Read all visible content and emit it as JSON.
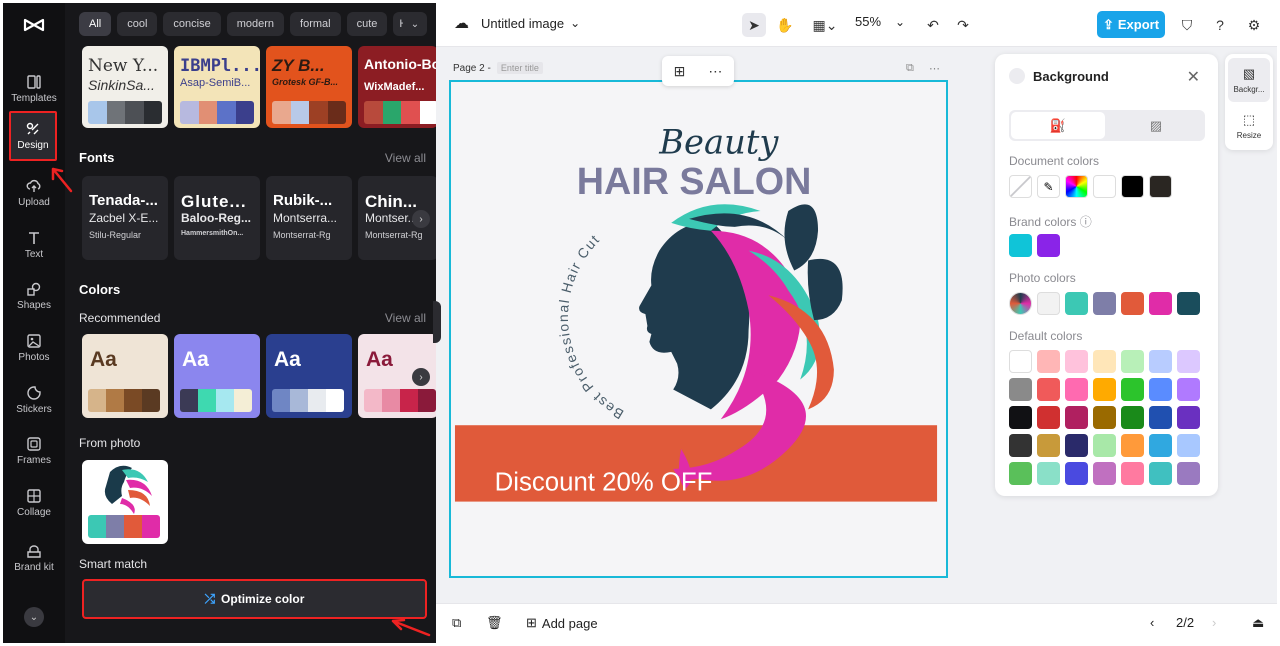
{
  "rail": {
    "items": [
      {
        "label": "Templates",
        "icon": "templates-icon"
      },
      {
        "label": "Design",
        "icon": "design-icon"
      },
      {
        "label": "Upload",
        "icon": "upload-icon"
      },
      {
        "label": "Text",
        "icon": "text-icon"
      },
      {
        "label": "Shapes",
        "icon": "shapes-icon"
      },
      {
        "label": "Photos",
        "icon": "photos-icon"
      },
      {
        "label": "Stickers",
        "icon": "stickers-icon"
      },
      {
        "label": "Frames",
        "icon": "frames-icon"
      },
      {
        "label": "Collage",
        "icon": "collage-icon"
      },
      {
        "label": "Brand kit",
        "icon": "brand-kit-icon"
      }
    ]
  },
  "panel": {
    "chips": [
      "All",
      "cool",
      "concise",
      "modern",
      "formal",
      "cute",
      "Holi"
    ],
    "theme_cards": [
      {
        "t1": "New Y...",
        "t2": "SinkinSa...",
        "bg": "#f1efe9",
        "fg": "#333",
        "swatches": [
          "#a8c6ea",
          "#6f7378",
          "#4d5055",
          "#2a2d31"
        ]
      },
      {
        "t1": "IBMPl...",
        "t2": "Asap-SemiB...",
        "bg": "#f3e4b8",
        "fg": "#3b3f8c",
        "swatches": [
          "#b7b9df",
          "#e18f74",
          "#5c72c8",
          "#3b3f8c"
        ]
      },
      {
        "t1": "ZY B...",
        "t2": "Grotesk GF-B...",
        "bg": "#e2531d",
        "fg": "#2b1a12",
        "swatches": [
          "#e9a88e",
          "#b8c9e8",
          "#9d4024",
          "#6a2c1a"
        ]
      },
      {
        "t1": "Antonio-Bo",
        "t2": "WixMadef...",
        "bg": "#8c1d23",
        "fg": "#fff",
        "swatches": [
          "#b84a3c",
          "#2aa66b",
          "#e05050",
          "#ffffff"
        ]
      }
    ],
    "fonts_title": "Fonts",
    "fonts_view_all": "View all",
    "font_cards": [
      {
        "a": "Tenada-...",
        "b": "Zacbel X-E...",
        "c": "Stilu-Regular"
      },
      {
        "a": "Glute...",
        "b": "Baloo-Reg...",
        "c": "HammersmithOn..."
      },
      {
        "a": "Rubik-...",
        "b": "Montserra...",
        "c": "Montserrat-Rg"
      },
      {
        "a": "Chin...",
        "b": "Montser...",
        "c": "Montserrat-Rg"
      }
    ],
    "colors_title": "Colors",
    "recommended_label": "Recommended",
    "colors_view_all": "View all",
    "color_cards": [
      {
        "aa": "Aa",
        "bg": "#efe4d6",
        "fg": "#5a3a22",
        "swatches": [
          "#d6b48a",
          "#b07a45",
          "#7a4a25",
          "#5a3a22"
        ]
      },
      {
        "aa": "Aa",
        "bg": "#8b86ee",
        "fg": "#fff",
        "swatches": [
          "#3b3a55",
          "#3ed9b0",
          "#a6e8f0",
          "#f4eed6"
        ]
      },
      {
        "aa": "Aa",
        "bg": "#2a3f8f",
        "fg": "#fff",
        "swatches": [
          "#6f86c4",
          "#a8b8d8",
          "#e8ebef",
          "#ffffff"
        ]
      },
      {
        "aa": "Aa",
        "bg": "#f3e3e8",
        "fg": "#8a1a3a",
        "swatches": [
          "#f3b8c8",
          "#e88aa4",
          "#c8244a",
          "#8a1a3a"
        ]
      }
    ],
    "from_photo_label": "From photo",
    "photo_swatches": [
      "#3cc8b4",
      "#7e7ea8",
      "#e15a3a",
      "#e02ca8"
    ],
    "smart_match_label": "Smart match",
    "optimize_label": "Optimize color"
  },
  "topbar": {
    "title": "Untitled image",
    "zoom": "55%",
    "export_label": "Export"
  },
  "canvas": {
    "page_label": "Page 2 -",
    "title_placeholder": "Enter title",
    "script_title": "Beauty",
    "main_title": "HAIR SALON",
    "arc_text": "Best Professional Hair Cut",
    "banner_text": "Discount 20% OFF",
    "banner_color": "#e05a3a"
  },
  "bottombar": {
    "add_page": "Add page",
    "page_counter": "2/2"
  },
  "bgpanel": {
    "title": "Background",
    "document_colors_label": "Document colors",
    "document_colors": [
      "transparent",
      "eyedropper",
      "gradient",
      "#ffffff",
      "#000000",
      "#2a2622"
    ],
    "brand_colors_label": "Brand colors",
    "brand_colors": [
      "#10c4d8",
      "#8a24e8"
    ],
    "photo_colors_label": "Photo colors",
    "photo_colors": [
      "image",
      "#f2f2f2",
      "#3cc8b4",
      "#7e7ea8",
      "#e15a3a",
      "#e02ca8",
      "#1a4d5c"
    ],
    "default_colors_label": "Default colors",
    "default_colors": [
      [
        "#ffffff",
        "#ffb6b6",
        "#ffc2dc",
        "#ffe6b8",
        "#b8f0b8",
        "#b8ccff",
        "#dcc8ff"
      ],
      [
        "#8a8a8a",
        "#f05a5a",
        "#ff6ab0",
        "#ffaa00",
        "#2cc42c",
        "#5a8cff",
        "#b07aff"
      ],
      [
        "#111114",
        "#d03030",
        "#b02060",
        "#9a6a00",
        "#1a8a1a",
        "#2050b0",
        "#6a30c0"
      ],
      [
        "#333333",
        "#c89a3a",
        "#2a2a6a",
        "#a8e8a8",
        "#ff9a3a",
        "#30a8e0",
        "#a8c8ff"
      ],
      [
        "#5ac05a",
        "#8ae0c8",
        "#4a4ae0",
        "#c070c0",
        "#ff7aa0",
        "#40c0c0",
        "#9a7ac0"
      ]
    ]
  },
  "side_tools": [
    {
      "label": "Backgr..."
    },
    {
      "label": "Resize"
    }
  ]
}
